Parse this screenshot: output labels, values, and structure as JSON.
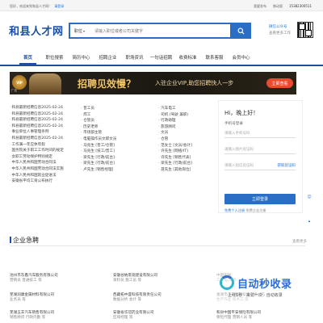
{
  "topbar": {
    "welcome": "您好，欢迎来到和县人才网！",
    "login": "请登录",
    "links": [
      "我要发布",
      "移动版"
    ],
    "phone": "15382300511"
  },
  "header": {
    "logo": "和县人才网",
    "search_type": "职位",
    "search_placeholder": "请输入职位或者公司关键字",
    "search_icon": "search-icon",
    "wx_line1": "微信公众号",
    "wx_line2": "查看更多工作"
  },
  "nav": {
    "items": [
      "首页",
      "职位搜索",
      "简历中心",
      "招聘企业",
      "职场资讯",
      "一句话招聘",
      "收费标准",
      "联系客服",
      "会员中心"
    ],
    "active_index": 0
  },
  "banner": {
    "vip_label": "VIP",
    "ad_label": "广告",
    "headline": "招聘见效慢？",
    "subline": "入驻企业VIP,助您招聘快人一步",
    "cta": "立即查看"
  },
  "news": [
    {
      "pre": "·",
      "text": "和县最新招聘信息2025-02-24"
    },
    {
      "pre": "·",
      "text": "和县最新招聘信息2025-02-24"
    },
    {
      "pre": "·",
      "text": "和县最新招聘信息2025-02-24"
    },
    {
      "pre": "·",
      "text": "和县最新招聘信息2025-02-24"
    },
    {
      "pre": "·",
      "text": "   事业单位人事管理条例"
    },
    {
      "pre": "·",
      "text": "和县最新招聘信息2025-02-24"
    },
    {
      "pre": "·",
      "text": "    工作满一年应休年假"
    },
    {
      "pre": "·",
      "text": "国务院关于职工工作时间的规定"
    },
    {
      "pre": "·",
      "text": "  女职工劳动保护特别规定"
    },
    {
      "pre": "·",
      "text": "  中华人民共和国劳动合同法"
    },
    {
      "pre": "·",
      "text": "中华人民共和国劳动合同法实施"
    },
    {
      "pre": "·",
      "text": "中华人民共和国就业促进法"
    },
    {
      "pre": "·",
      "text": "  安徽省平均工资公布执行"
    }
  ],
  "jobs_col2": [
    "普工员",
    "焊工",
    "仓管员",
    "历史老师",
    "市场部主管",
    "电脑操作员文职文员",
    "马兆生 [普工/仓管]",
    "马兆生 [技工/普工]",
    "梁先生 [行政/前台]",
    "梁先生 [行政/前台]",
    "卢先生 [销售经理]"
  ],
  "jobs_col3": [
    "汽车电工",
    "司机 (驾驶 兼职)",
    "行政助理",
    "旅游顾问",
    "文员",
    "仓管",
    "范女士 [文员/会计]",
    "许先生 [网络/IT]",
    "许先生 [销售代表]",
    "梁先生 [行政/前台]",
    "聂先生 [其他岗位]"
  ],
  "login": {
    "greeting": "Hi，晚上好！",
    "label": "手机号登录",
    "phone_placeholder": "请输入手机号码",
    "captcha_placeholder": "请输入图片验证码",
    "code_placeholder": "请输入短信验证码",
    "get_code": "获取验证码",
    "submit": "立即登录",
    "register_link": "免费个人注册",
    "register_company": "免费企业注册"
  },
  "section": {
    "title": "企业急聘",
    "more": "查看更多"
  },
  "companies": [
    {
      "name": "池州市东鑫汽车服务有限公司",
      "jobs": "营销员 普通技工 等"
    },
    {
      "name": "安徽谷纳景观建设有限公司",
      "jobs": "资料员 施工员 等"
    },
    {
      "name": "中国银联",
      "jobs": "工厂电工 等"
    },
    {
      "name": "芜湖润康金属材料有限公司",
      "jobs": "业务员 等"
    },
    {
      "name": "西藏拓中盛科技有限责任公司",
      "jobs": "数据分析 会计 等"
    },
    {
      "name": "巢湖市蓝天物联科技有限公司",
      "jobs": "生产作业 技术工 等"
    },
    {
      "name": "芜湖五羊汽车销售有限公司",
      "jobs": "销售顾问 行政内勤 等"
    },
    {
      "name": "安徽省华冠药业有限公司",
      "jobs": "区域经理 等"
    },
    {
      "name": "和县中国平安保险有限公司",
      "jobs": "保险代理 营销人员 等"
    }
  ],
  "watermark": {
    "brand": "自动秒收录",
    "slogan": "上线1秒 · 来访一次 · 自动收录"
  }
}
